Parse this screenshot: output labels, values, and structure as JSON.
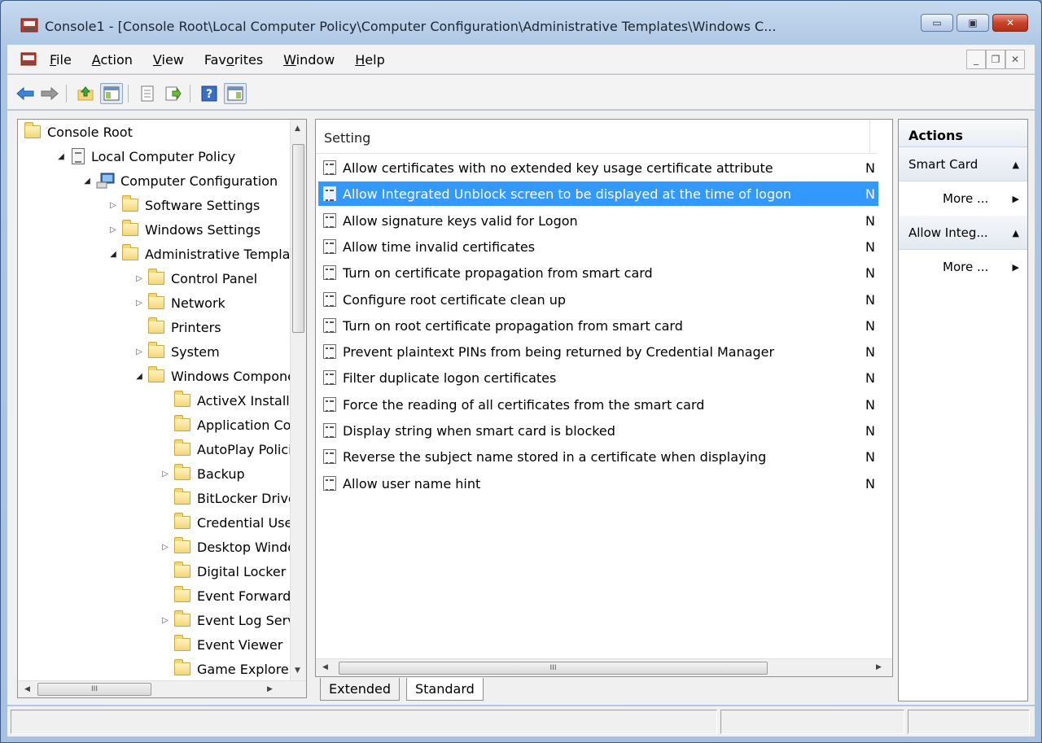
{
  "window": {
    "title": "Console1 - [Console Root\\Local Computer Policy\\Computer Configuration\\Administrative Templates\\Windows C...",
    "caption_buttons": [
      "minimize-icon",
      "maximize-icon",
      "close-icon"
    ]
  },
  "menubar": {
    "items": [
      {
        "label": "File",
        "accel": "F"
      },
      {
        "label": "Action",
        "accel": "A"
      },
      {
        "label": "View",
        "accel": "V"
      },
      {
        "label": "Favorites",
        "accel": "o"
      },
      {
        "label": "Window",
        "accel": "W"
      },
      {
        "label": "Help",
        "accel": "H"
      }
    ],
    "mdi_buttons": [
      "minimize-icon",
      "restore-icon",
      "close-icon"
    ]
  },
  "toolbar": {
    "buttons": [
      "back-arrow-icon",
      "forward-arrow-icon",
      "up-folder-icon",
      "show-hide-tree-icon",
      "properties-icon",
      "export-list-icon",
      "help-icon",
      "show-hide-action-pane-icon"
    ]
  },
  "tree": {
    "items": [
      {
        "label": "Console Root",
        "level": 0,
        "icon": "folder",
        "expander": ""
      },
      {
        "label": "Local Computer Policy",
        "level": 1,
        "icon": "policy-doc",
        "expander": "open"
      },
      {
        "label": "Computer Configuration",
        "level": 2,
        "icon": "computer",
        "expander": "open"
      },
      {
        "label": "Software Settings",
        "level": 3,
        "icon": "folder",
        "expander": "closed"
      },
      {
        "label": "Windows Settings",
        "level": 3,
        "icon": "folder",
        "expander": "closed"
      },
      {
        "label": "Administrative Templates",
        "level": 3,
        "icon": "folder",
        "expander": "open"
      },
      {
        "label": "Control Panel",
        "level": 4,
        "icon": "folder",
        "expander": "closed"
      },
      {
        "label": "Network",
        "level": 4,
        "icon": "folder",
        "expander": "closed"
      },
      {
        "label": "Printers",
        "level": 4,
        "icon": "folder",
        "expander": ""
      },
      {
        "label": "System",
        "level": 4,
        "icon": "folder",
        "expander": "closed"
      },
      {
        "label": "Windows Components",
        "level": 4,
        "icon": "folder",
        "expander": "open"
      },
      {
        "label": "ActiveX Installer Service",
        "level": 5,
        "icon": "folder",
        "expander": ""
      },
      {
        "label": "Application Compatibility",
        "level": 5,
        "icon": "folder",
        "expander": ""
      },
      {
        "label": "AutoPlay Policies",
        "level": 5,
        "icon": "folder",
        "expander": ""
      },
      {
        "label": "Backup",
        "level": 5,
        "icon": "folder",
        "expander": "closed"
      },
      {
        "label": "BitLocker Drive Encryption",
        "level": 5,
        "icon": "folder",
        "expander": ""
      },
      {
        "label": "Credential User Interface",
        "level": 5,
        "icon": "folder",
        "expander": ""
      },
      {
        "label": "Desktop Window Manager",
        "level": 5,
        "icon": "folder",
        "expander": "closed"
      },
      {
        "label": "Digital Locker",
        "level": 5,
        "icon": "folder",
        "expander": ""
      },
      {
        "label": "Event Forwarding",
        "level": 5,
        "icon": "folder",
        "expander": ""
      },
      {
        "label": "Event Log Service",
        "level": 5,
        "icon": "folder",
        "expander": "closed"
      },
      {
        "label": "Event Viewer",
        "level": 5,
        "icon": "folder",
        "expander": ""
      },
      {
        "label": "Game Explorer",
        "level": 5,
        "icon": "folder",
        "expander": ""
      }
    ],
    "scroll_grip": "III"
  },
  "list": {
    "column_setting": "Setting",
    "rows": [
      {
        "label": "Allow certificates with no extended key usage certificate attribute",
        "state": "N",
        "selected": false
      },
      {
        "label": "Allow Integrated Unblock screen to be displayed at the time of logon",
        "state": "N",
        "selected": true
      },
      {
        "label": "Allow signature keys valid for Logon",
        "state": "N",
        "selected": false
      },
      {
        "label": "Allow time invalid certificates",
        "state": "N",
        "selected": false
      },
      {
        "label": "Turn on certificate propagation from smart card",
        "state": "N",
        "selected": false
      },
      {
        "label": "Configure root certificate clean up",
        "state": "N",
        "selected": false
      },
      {
        "label": "Turn on root certificate propagation from smart card",
        "state": "N",
        "selected": false
      },
      {
        "label": "Prevent plaintext PINs from being returned by Credential Manager",
        "state": "N",
        "selected": false
      },
      {
        "label": "Filter duplicate logon certificates",
        "state": "N",
        "selected": false
      },
      {
        "label": "Force the reading of all certificates from the smart card",
        "state": "N",
        "selected": false
      },
      {
        "label": "Display string when smart card is blocked",
        "state": "N",
        "selected": false
      },
      {
        "label": "Reverse the subject name stored in a certificate when displaying",
        "state": "N",
        "selected": false
      },
      {
        "label": "Allow user name hint",
        "state": "N",
        "selected": false
      }
    ],
    "scroll_grip": "III",
    "tabs": [
      "Extended",
      "Standard"
    ],
    "active_tab": "Standard"
  },
  "actions": {
    "header": "Actions",
    "groups": [
      {
        "title": "Smart Card",
        "more": "More ..."
      },
      {
        "title": "Allow Integ...",
        "more": "More ..."
      }
    ]
  },
  "colors": {
    "selection": "#3399ff",
    "titlebar": "#aec6e4",
    "close_button": "#c9422a"
  }
}
